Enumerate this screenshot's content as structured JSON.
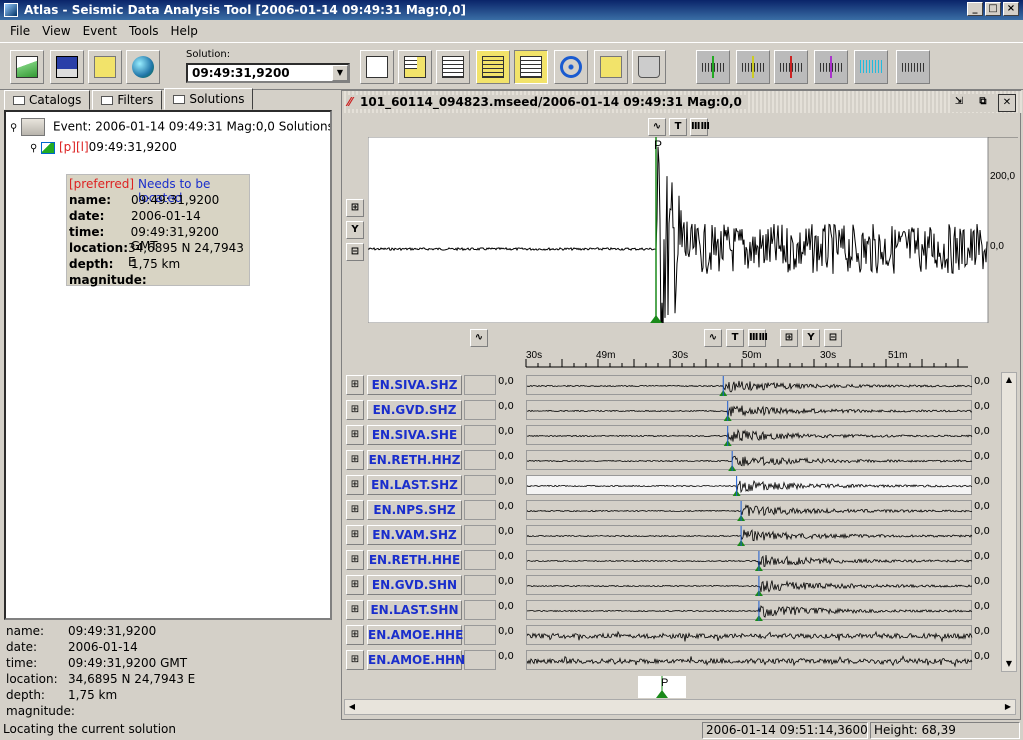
{
  "window": {
    "title": "Atlas - Seismic Data Analysis Tool [2006-01-14 09:49:31 Mag:0,0]"
  },
  "menu": [
    "File",
    "View",
    "Event",
    "Tools",
    "Help"
  ],
  "toolbar": {
    "solution_label": "Solution:",
    "solution_value": "09:49:31,9200"
  },
  "tabs": [
    "Catalogs",
    "Filters",
    "Solutions"
  ],
  "tree": {
    "event_label": "Event: 2006-01-14 09:49:31 Mag:0,0 Solutions",
    "solution_prefix": "[p][l]",
    "solution_time": "09:49:31,9200"
  },
  "tooltip": {
    "preferred": "[preferred]",
    "status": "Needs to be located",
    "fields": [
      {
        "k": "name:",
        "v": "09:49:31,9200"
      },
      {
        "k": "date:",
        "v": "2006-01-14"
      },
      {
        "k": "time:",
        "v": "09:49:31,9200 GMT"
      },
      {
        "k": "location:",
        "v": "34,6895 N 24,7943 E"
      },
      {
        "k": "depth:",
        "v": "1,75 km"
      },
      {
        "k": "magnitude:",
        "v": ""
      }
    ]
  },
  "info": [
    {
      "k": "name:",
      "v": "09:49:31,9200"
    },
    {
      "k": "date:",
      "v": "2006-01-14"
    },
    {
      "k": "time:",
      "v": "09:49:31,9200 GMT"
    },
    {
      "k": "location:",
      "v": "34,6895 N 24,7943 E"
    },
    {
      "k": "depth:",
      "v": "1,75 km"
    },
    {
      "k": "magnitude:",
      "v": ""
    }
  ],
  "viewer": {
    "title": "101_60114_094823.mseed/2006-01-14 09:49:31 Mag:0,0",
    "pick_label": "P",
    "y_labels": [
      "200,0",
      "0,0"
    ],
    "axis_ticks": [
      "30s",
      "49m",
      "30s",
      "50m",
      "30s",
      "51m"
    ],
    "zero": "0,0"
  },
  "stations": [
    "EN.SIVA.SHZ",
    "EN.GVD.SHZ",
    "EN.SIVA.SHE",
    "EN.RETH.HHZ",
    "EN.LAST.SHZ",
    "EN.NPS.SHZ",
    "EN.VAM.SHZ",
    "EN.RETH.HHE",
    "EN.GVD.SHN",
    "EN.LAST.SHN",
    "EN.AMOE.HHE",
    "EN.AMOE.HHN"
  ],
  "status": {
    "message": "Locating the current solution",
    "time": "2006-01-14 09:51:14,3600",
    "height": "Height: 68,39"
  }
}
